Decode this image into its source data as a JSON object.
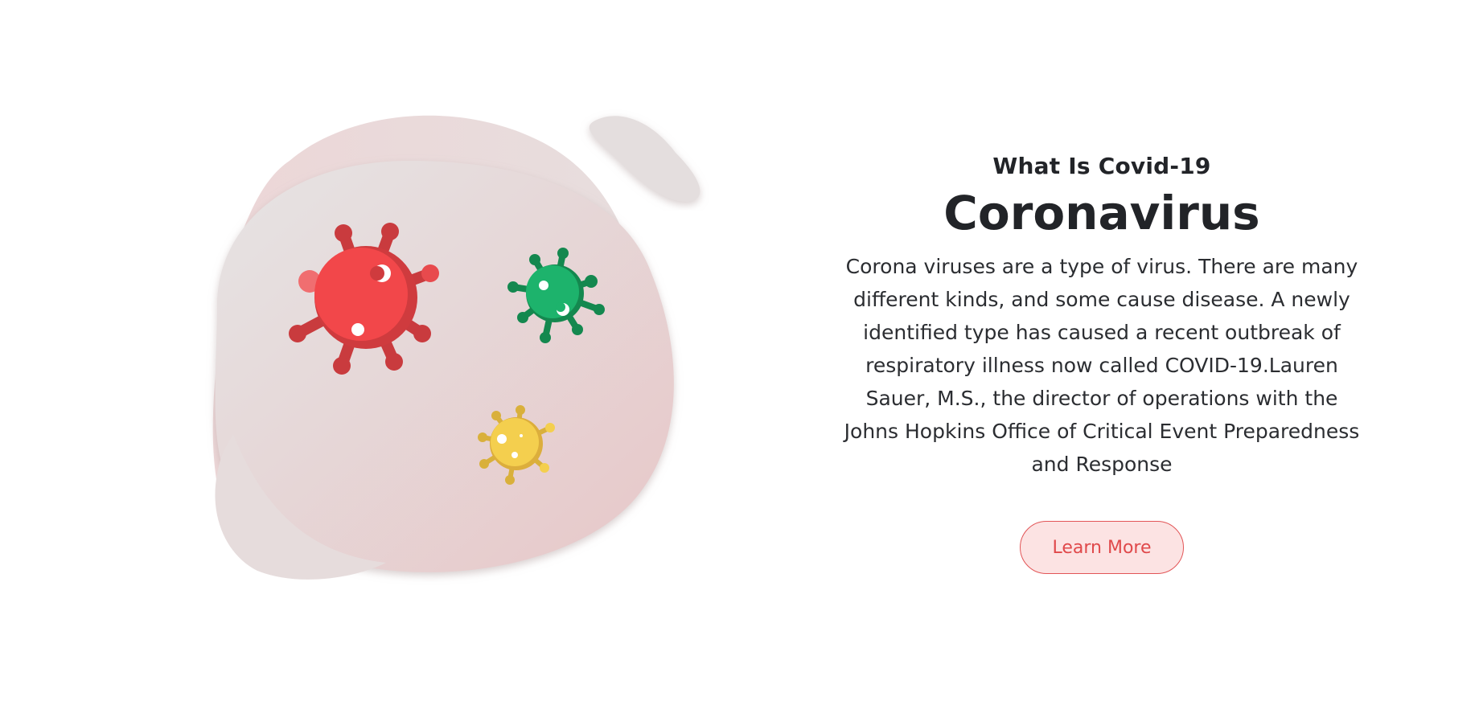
{
  "section": {
    "eyebrow": "What Is Covid-19",
    "headline": "Coronavirus",
    "description": "Corona viruses are a type of virus. There are many different kinds, and some cause disease. A newly identified type has caused a recent outbreak of respiratory illness now called COVID-19.Lauren Sauer, M.S., the director of operations with the Johns Hopkins Office of Critical Event Preparedness and Response",
    "cta_label": "Learn More"
  },
  "illustration": {
    "icons": [
      "blob-background",
      "red-virus-icon",
      "green-virus-icon",
      "yellow-virus-icon"
    ]
  },
  "colors": {
    "accent": "#e25557",
    "accent_bg": "#fce3e3",
    "text": "#222428",
    "blob": "#e8d6d6",
    "virus_red": "#f2474a",
    "virus_green": "#1aa866",
    "virus_yellow": "#f4cf4e"
  }
}
